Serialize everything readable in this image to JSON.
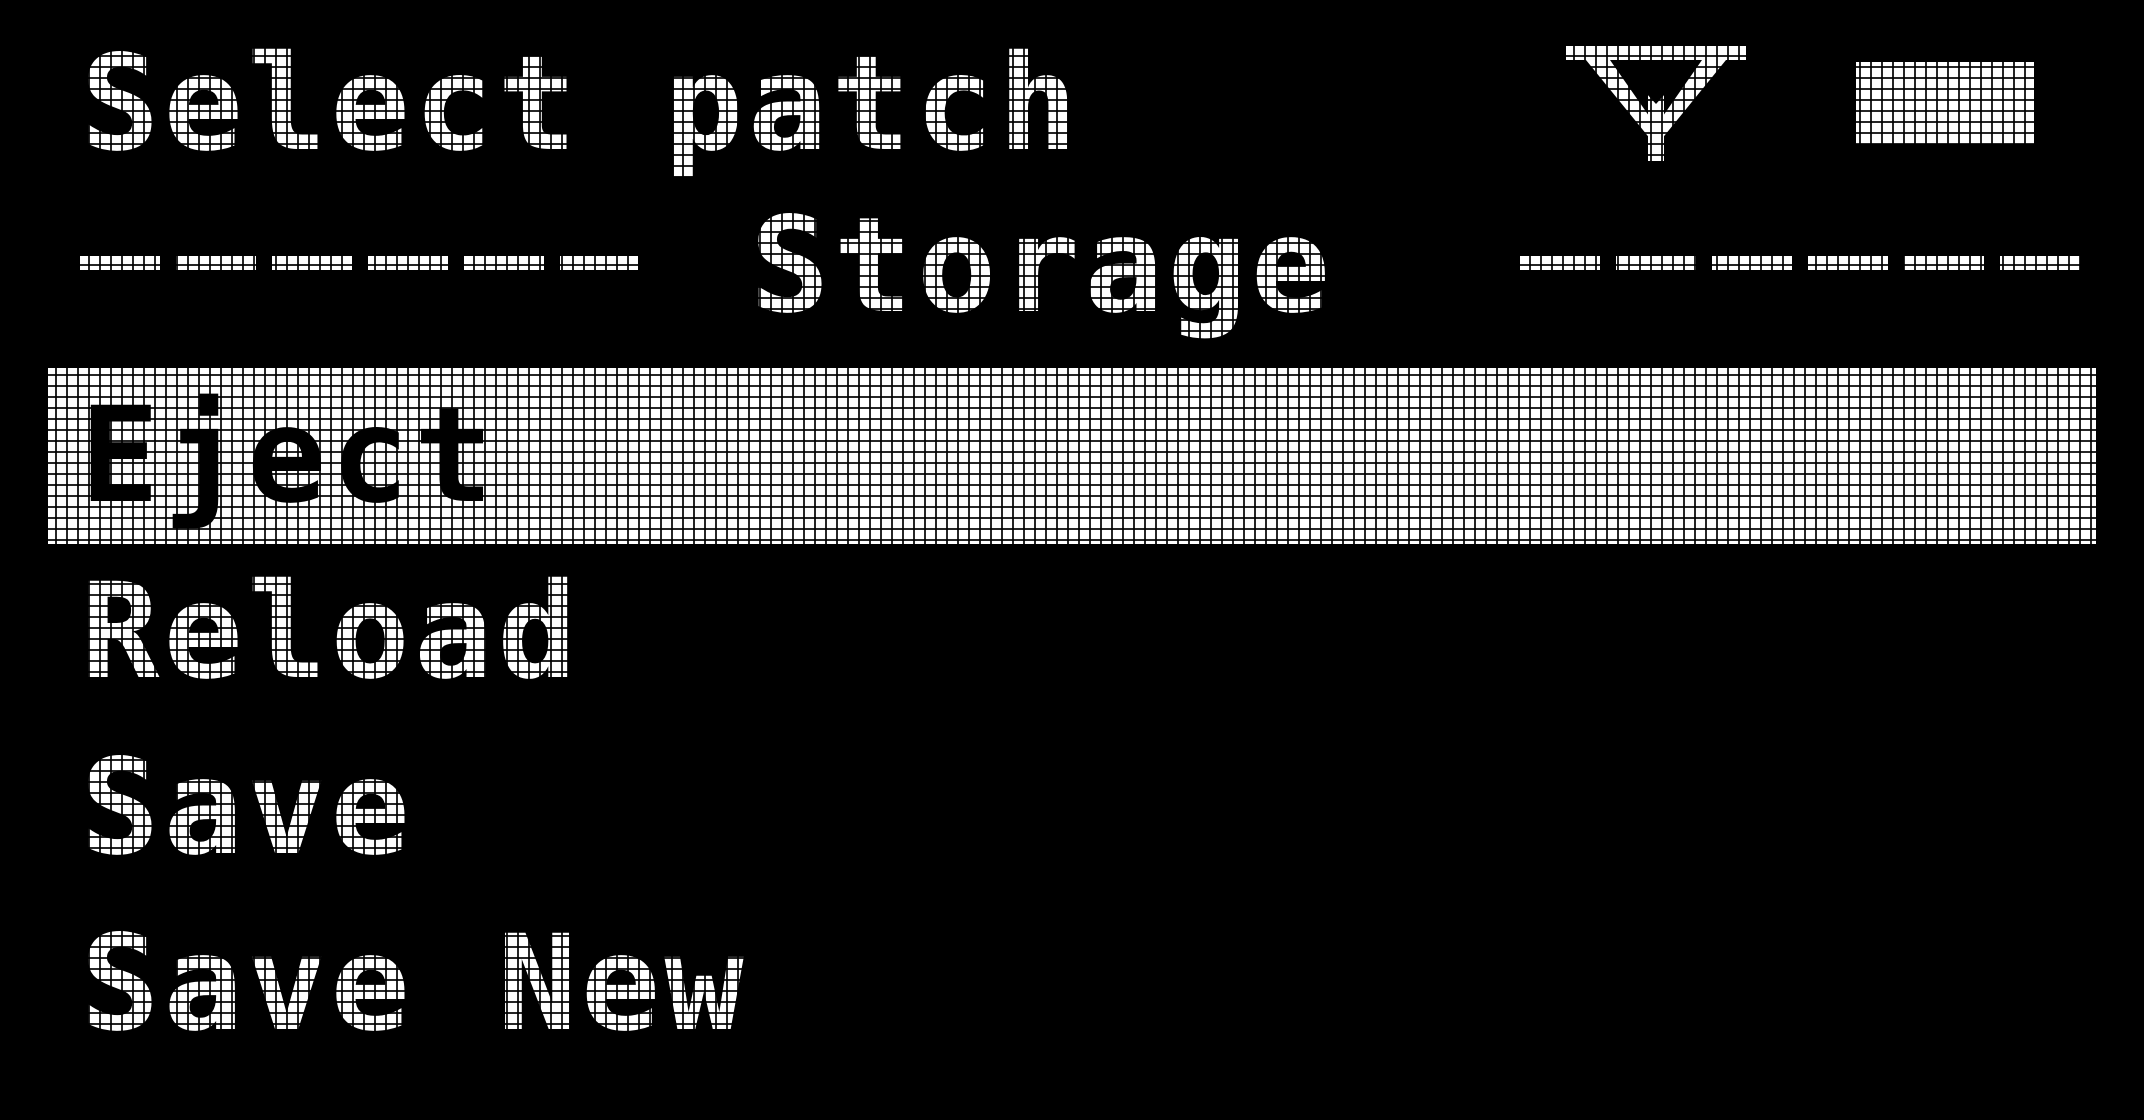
{
  "header": {
    "title": "Select patch",
    "icons": [
      "midi-icon",
      "battery-icon"
    ]
  },
  "section": {
    "title": "Storage"
  },
  "menu": {
    "selected_index": 0,
    "items": [
      {
        "label": "Eject"
      },
      {
        "label": "Reload"
      },
      {
        "label": "Save"
      },
      {
        "label": "Save New"
      }
    ]
  },
  "colors": {
    "background": "#000000",
    "foreground": "#ffffff"
  }
}
